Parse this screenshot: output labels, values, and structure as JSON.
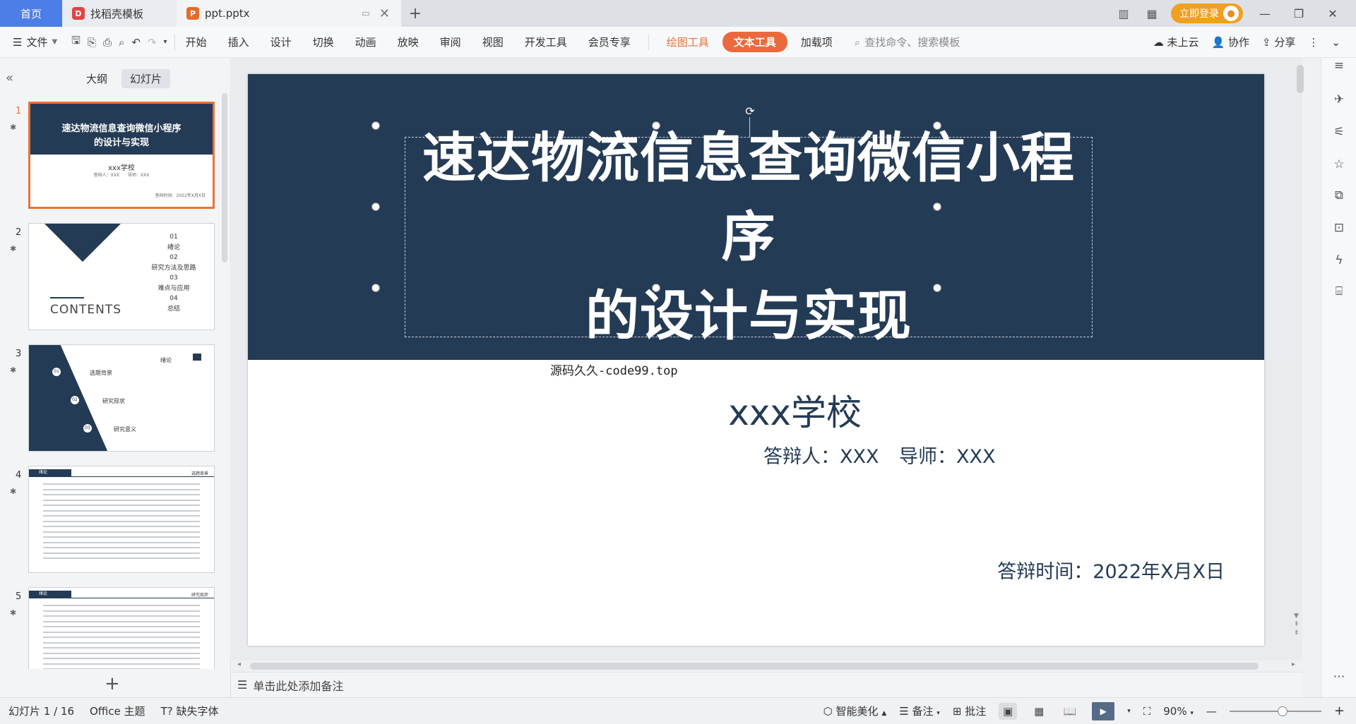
{
  "tabbar": {
    "home": "首页",
    "template": "找稻壳模板",
    "template_logo": "D",
    "document": "ppt.pptx",
    "document_logo": "P",
    "login": "立即登录"
  },
  "ribbon": {
    "file": "文件",
    "tabs": [
      "开始",
      "插入",
      "设计",
      "切换",
      "动画",
      "放映",
      "审阅",
      "视图",
      "开发工具",
      "会员专享"
    ],
    "draw_tools": "绘图工具",
    "text_tools": "文本工具",
    "addons": "加载项",
    "search_placeholder": "查找命令、搜索模板",
    "cloud": "未上云",
    "collab": "协作",
    "share": "分享"
  },
  "left_panel": {
    "tab_outline": "大纲",
    "tab_slides": "幻灯片",
    "slide_numbers": [
      "1",
      "2",
      "3",
      "4",
      "5"
    ],
    "thumb1": {
      "title_line1": "速达物流信息查询微信小程序",
      "title_line2": "的设计与实现",
      "school": "xxx学校",
      "small": "答辩人：XXX　　导师：XXX",
      "date": "答辩时间：2022年X月X日"
    },
    "thumb2": {
      "items": [
        "01",
        "绪论",
        "02",
        "研究方法及思路",
        "03",
        "难点与应用",
        "04",
        "总结"
      ],
      "contents": "CONTENTS"
    },
    "thumb3": {
      "title": "绪论",
      "items": [
        {
          "num": "01",
          "label": "选题背景"
        },
        {
          "num": "02",
          "label": "研究现状"
        },
        {
          "num": "03",
          "label": "研究意义"
        }
      ]
    },
    "thumb4": {
      "head": "绪论",
      "sub": "选题背景"
    },
    "thumb5": {
      "head": "绪论",
      "sub": "研究现状"
    }
  },
  "slide": {
    "title_line1": "速达物流信息查询微信小程序",
    "title_line2": "的设计与实现",
    "watermark": "源码久久-code99.top",
    "school": "xxx学校",
    "defender": "答辩人：XXX",
    "advisor": "导师：XXX",
    "date": "答辩时间：2022年X月X日"
  },
  "notes_placeholder": "单击此处添加备注",
  "status": {
    "slide_counter": "幻灯片 1 / 16",
    "theme": "Office 主题",
    "missing_font": "缺失字体",
    "beautify": "智能美化",
    "notes": "备注",
    "comments": "批注",
    "zoom": "90%"
  },
  "colors": {
    "slide_navy": "#243b55",
    "accent_orange": "#ea6a3d",
    "home_tab_blue": "#4d7ee8",
    "login_gold": "#f0a020"
  }
}
